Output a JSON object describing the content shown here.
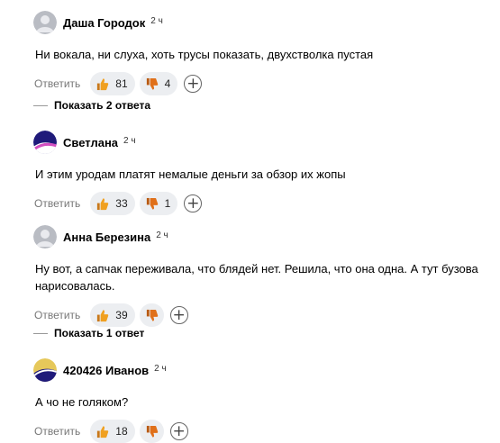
{
  "reply_label": "Ответить",
  "comments": [
    {
      "author": "Даша Городок",
      "time": "2 ч",
      "text": "Ни вокала, ни слуха, хоть трусы показать, двухстволка пустая",
      "likes": "81",
      "dislikes": "4",
      "avatar": "default-avatar"
    },
    {
      "author": "Светлана",
      "time": "2 ч",
      "text": "И этим уродам платят немалые деньги за обзор их жопы",
      "likes": "33",
      "dislikes": "1",
      "avatar": "purple-swoosh-avatar"
    },
    {
      "author": "Анна Березина",
      "time": "2 ч",
      "text": "Ну вот, а сапчак переживала, что блядей нет. Решила, что она одна. А тут бузова нарисовалась.",
      "likes": "39",
      "dislikes": "",
      "avatar": "default-avatar"
    },
    {
      "author": "420426 Иванов",
      "time": "2 ч",
      "text": "А чо не голяком?",
      "likes": "18",
      "dislikes": "",
      "avatar": "yellow-swoosh-avatar"
    }
  ],
  "show_replies": [
    "Показать 2 ответа",
    "Показать 1 ответ"
  ],
  "colors": {
    "pill_bg": "#eceef1",
    "thumb_up": "#f0a020",
    "thumb_down": "#e0701a",
    "reply_text": "#777777"
  }
}
